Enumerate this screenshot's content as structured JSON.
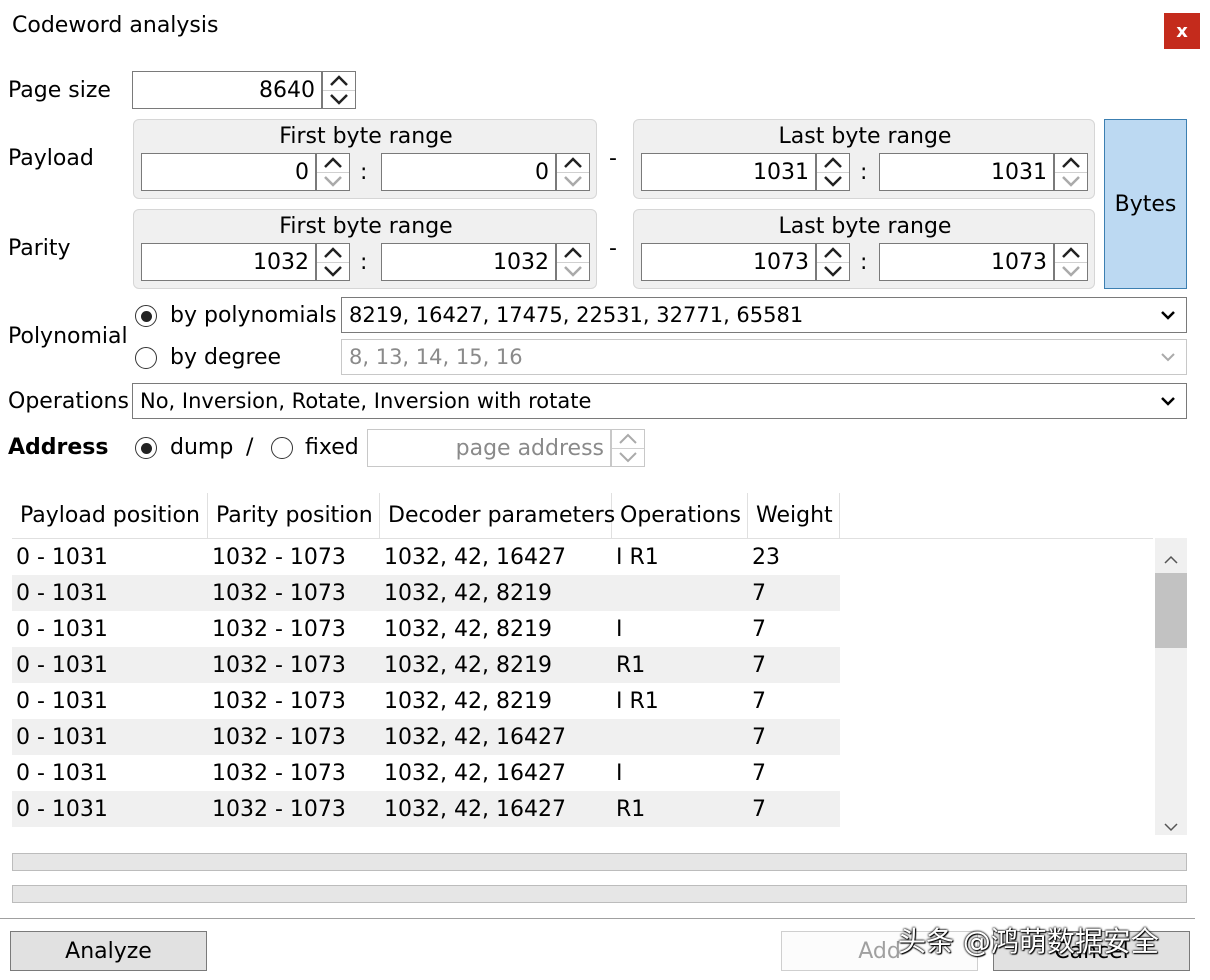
{
  "window": {
    "title": "Codeword analysis",
    "close_glyph": "x"
  },
  "page_size": {
    "label": "Page size",
    "value": "8640"
  },
  "payload": {
    "label": "Payload",
    "first_title": "First byte range",
    "last_title": "Last byte range",
    "first_from": "0",
    "first_to": "0",
    "last_from": "1031",
    "last_to": "1031"
  },
  "parity": {
    "label": "Parity",
    "first_title": "First byte range",
    "last_title": "Last byte range",
    "first_from": "1032",
    "first_to": "1032",
    "last_from": "1073",
    "last_to": "1073"
  },
  "sep": {
    "colon": ":",
    "dash": "-"
  },
  "bytes_button": "Bytes",
  "polynomial": {
    "label": "Polynomial",
    "by_polynomials_label": "by polynomials",
    "by_polynomials_value": "8219, 16427, 17475, 22531, 32771, 65581",
    "by_degree_label": "by degree",
    "by_degree_value": "8, 13, 14, 15, 16"
  },
  "operations": {
    "label": "Operations",
    "value": "No, Inversion, Rotate, Inversion with rotate"
  },
  "address": {
    "label": "Address",
    "dump_label": "dump",
    "slash": "/",
    "fixed_label": "fixed",
    "page_address_placeholder": "page address"
  },
  "table": {
    "columns": [
      "Payload position",
      "Parity position",
      "Decoder parameters",
      "Operations",
      "Weight"
    ],
    "rows": [
      [
        "0 - 1031",
        "1032 - 1073",
        "1032, 42, 16427",
        "I R1",
        "23"
      ],
      [
        "0 - 1031",
        "1032 - 1073",
        "1032, 42, 8219",
        "",
        "7"
      ],
      [
        "0 - 1031",
        "1032 - 1073",
        "1032, 42, 8219",
        "I",
        "7"
      ],
      [
        "0 - 1031",
        "1032 - 1073",
        "1032, 42, 8219",
        "R1",
        "7"
      ],
      [
        "0 - 1031",
        "1032 - 1073",
        "1032, 42, 8219",
        "I R1",
        "7"
      ],
      [
        "0 - 1031",
        "1032 - 1073",
        "1032, 42, 16427",
        "",
        "7"
      ],
      [
        "0 - 1031",
        "1032 - 1073",
        "1032, 42, 16427",
        "I",
        "7"
      ],
      [
        "0 - 1031",
        "1032 - 1073",
        "1032, 42, 16427",
        "R1",
        "7"
      ]
    ]
  },
  "buttons": {
    "analyze": "Analyze",
    "add": "Add",
    "cancel": "Cancel"
  },
  "watermark": "头条 @鸿萌数据安全"
}
